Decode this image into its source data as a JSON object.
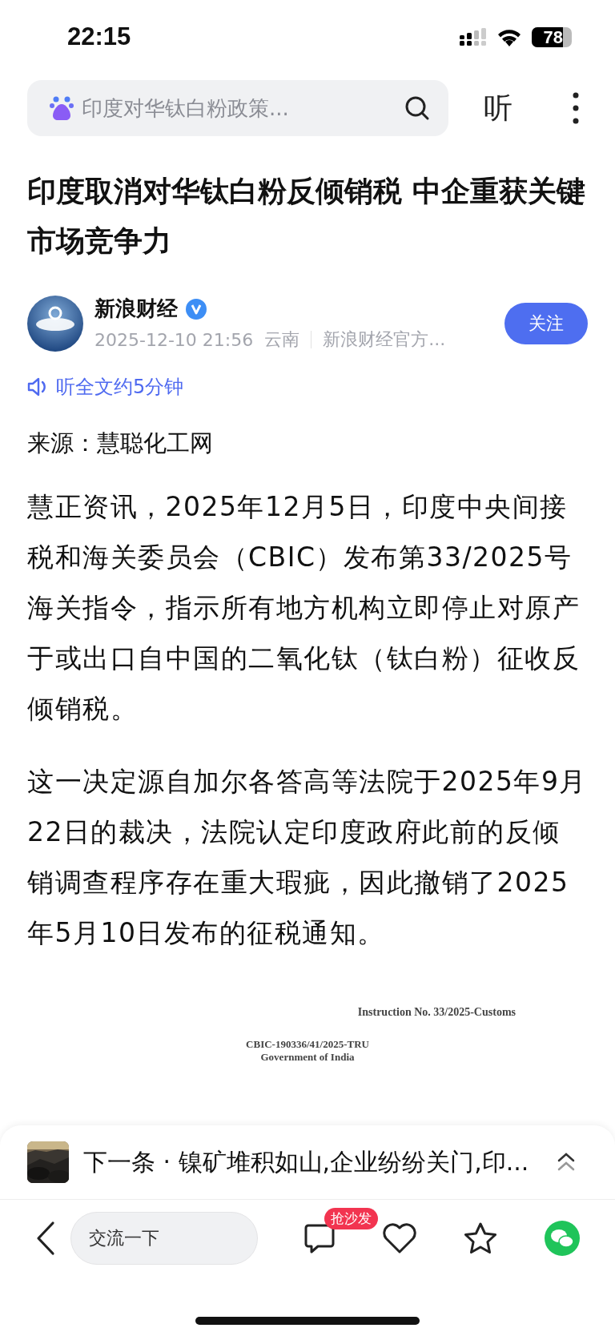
{
  "status_bar": {
    "time": "22:15",
    "battery": "78"
  },
  "search": {
    "placeholder": "印度对华钛白粉政策..."
  },
  "listen_button": "听",
  "title": "印度取消对华钛白粉反倾销税 中企重获关键市场竞争力",
  "author": {
    "name": "新浪财经",
    "verified": true,
    "time": "2025-12-10 21:56",
    "location": "云南",
    "description": "新浪财经官方...",
    "follow": "关注"
  },
  "audio": "听全文约5分钟",
  "source": "来源：慧聪化工网",
  "paragraphs": [
    "慧正资讯，2025年12月5日，印度中央间接税和海关委员会（CBIC）发布第33/2025号海关指令，指示所有地方机构立即停止对原产于或出口自中国的二氧化钛（钛白粉）征收反倾销税。",
    "这一决定源自加尔各答高等法院于2025年9月22日的裁决，法院认定印度政府此前的反倾销调查程序存在重大瑕疵，因此撤销了2025年5月10日发布的征税通知。"
  ],
  "document": {
    "instruction": "Instruction No. 33/2025-Customs",
    "file_no": "CBIC-190336/41/2025-TRU",
    "heading": "Government of India"
  },
  "next_item": {
    "kind": "picture",
    "label": "下一条 · 镍矿堆积如山,企业纷纷关门,印..."
  },
  "toolbar": {
    "comment_placeholder": "交流一下",
    "comment_badge": "抢沙发"
  }
}
